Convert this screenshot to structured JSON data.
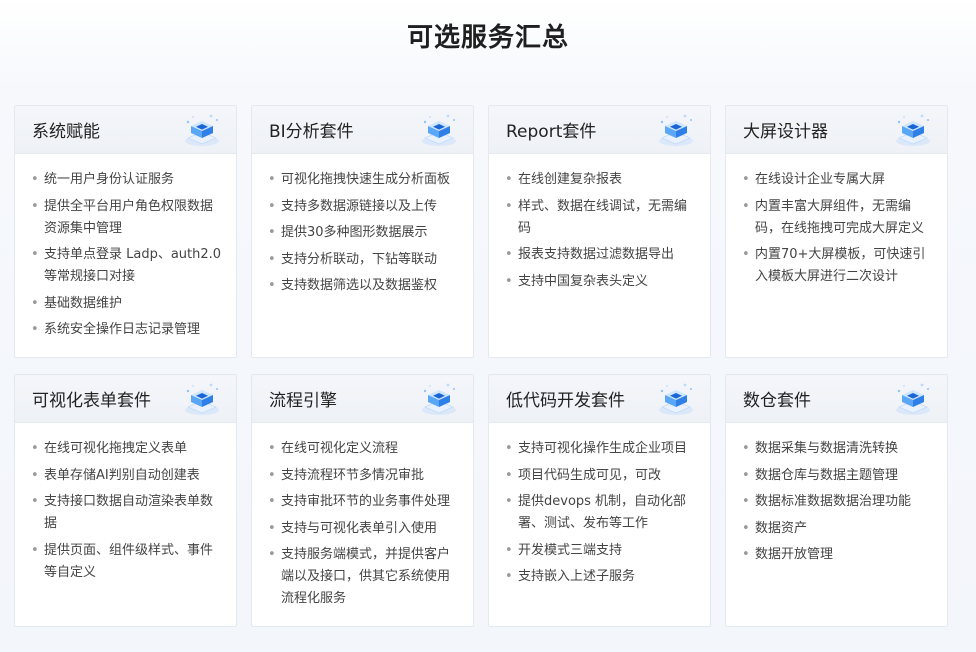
{
  "page": {
    "title": "可选服务汇总"
  },
  "cards": [
    {
      "title": "系统赋能",
      "icon": "cube-stack-icon",
      "items": [
        "统一用户身份认证服务",
        "提供全平台用户角色权限数据资源集中管理",
        "支持单点登录 Ladp、auth2.0等常规接口对接",
        "基础数据维护",
        "系统安全操作日志记录管理"
      ]
    },
    {
      "title": "BI分析套件",
      "icon": "cube-stack-icon",
      "items": [
        "可视化拖拽快速生成分析面板",
        "支持多数据源链接以及上传",
        "提供30多种图形数据展示",
        "支持分析联动，下钻等联动",
        "支持数据筛选以及数据鉴权"
      ]
    },
    {
      "title": "Report套件",
      "icon": "cube-stack-icon",
      "items": [
        "在线创建复杂报表",
        "样式、数据在线调试，无需编码",
        "报表支持数据过滤数据导出",
        "支持中国复杂表头定义"
      ]
    },
    {
      "title": "大屏设计器",
      "icon": "cube-stack-icon",
      "items": [
        "在线设计企业专属大屏",
        "内置丰富大屏组件，无需编码，在线拖拽可完成大屏定义",
        "内置70+大屏模板，可快速引入模板大屏进行二次设计"
      ]
    },
    {
      "title": "可视化表单套件",
      "icon": "cube-stack-icon",
      "items": [
        "在线可视化拖拽定义表单",
        "表单存储AI判别自动创建表",
        "支持接口数据自动渲染表单数据",
        "提供页面、组件级样式、事件等自定义"
      ]
    },
    {
      "title": "流程引擎",
      "icon": "cube-stack-icon",
      "items": [
        "在线可视化定义流程",
        "支持流程环节多情况审批",
        "支持审批环节的业务事件处理",
        "支持与可视化表单引入使用",
        "支持服务端模式，并提供客户端以及接口，供其它系统使用流程化服务"
      ]
    },
    {
      "title": "低代码开发套件",
      "icon": "cube-stack-icon",
      "items": [
        "支持可视化操作生成企业项目",
        "项目代码生成可见，可改",
        "提供devops 机制，自动化部署、测试、发布等工作",
        "开发模式三端支持",
        "支持嵌入上述子服务"
      ]
    },
    {
      "title": "数仓套件",
      "icon": "cube-stack-icon",
      "items": [
        "数据采集与数据清洗转换",
        "数据仓库与数据主题管理",
        "数据标准数据数据治理功能",
        "数据资产",
        "数据开放管理"
      ]
    }
  ],
  "colors": {
    "icon_top": "#cfe6ff",
    "icon_left": "#5aa7f7",
    "icon_right": "#2f7fe8",
    "icon_core": "#1a66d6",
    "icon_shadow": "#dbe8fa"
  }
}
